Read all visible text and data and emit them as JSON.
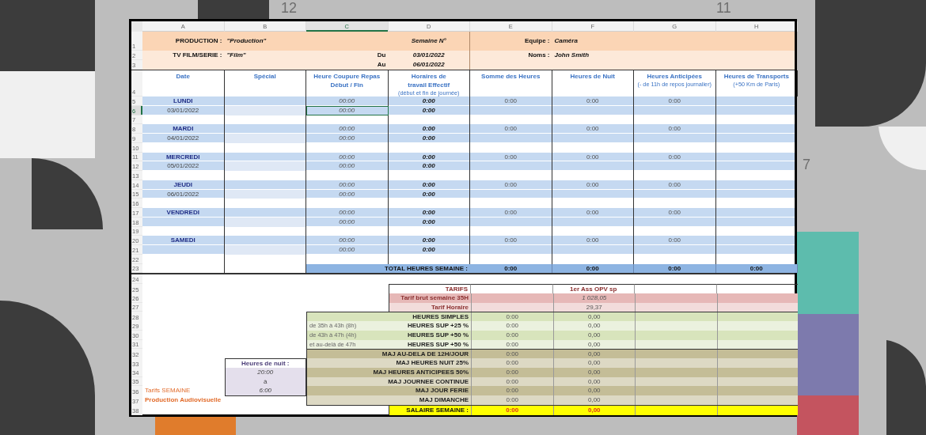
{
  "backdrop_labels": [
    "12",
    "11",
    "7"
  ],
  "column_headers": [
    {
      "label": "A",
      "selected": false
    },
    {
      "label": "B",
      "selected": false
    },
    {
      "label": "C",
      "selected": true
    },
    {
      "label": "D",
      "selected": false
    },
    {
      "label": "E",
      "selected": false
    },
    {
      "label": "F",
      "selected": false
    },
    {
      "label": "G",
      "selected": false
    },
    {
      "label": "H",
      "selected": false
    }
  ],
  "row_numbers": [
    {
      "label": "1",
      "selected": false
    },
    {
      "label": "2",
      "selected": false
    },
    {
      "label": "3",
      "selected": false
    },
    {
      "label": "4",
      "selected": false
    },
    {
      "label": "5",
      "selected": false
    },
    {
      "label": "6",
      "selected": true
    },
    {
      "label": "7",
      "selected": false
    },
    {
      "label": "8",
      "selected": false
    },
    {
      "label": "9",
      "selected": false
    },
    {
      "label": "10",
      "selected": false
    },
    {
      "label": "11",
      "selected": false
    },
    {
      "label": "12",
      "selected": false
    },
    {
      "label": "13",
      "selected": false
    },
    {
      "label": "14",
      "selected": false
    },
    {
      "label": "15",
      "selected": false
    },
    {
      "label": "16",
      "selected": false
    },
    {
      "label": "17",
      "selected": false
    },
    {
      "label": "18",
      "selected": false
    },
    {
      "label": "19",
      "selected": false
    },
    {
      "label": "20",
      "selected": false
    },
    {
      "label": "21",
      "selected": false
    },
    {
      "label": "22",
      "selected": false
    },
    {
      "label": "23",
      "selected": false
    },
    {
      "label": "24",
      "selected": false
    },
    {
      "label": "25",
      "selected": false
    },
    {
      "label": "26",
      "selected": false
    },
    {
      "label": "27",
      "selected": false
    },
    {
      "label": "28",
      "selected": false
    },
    {
      "label": "29",
      "selected": false
    },
    {
      "label": "30",
      "selected": false
    },
    {
      "label": "31",
      "selected": false
    },
    {
      "label": "32",
      "selected": false
    },
    {
      "label": "33",
      "selected": false
    },
    {
      "label": "34",
      "selected": false
    },
    {
      "label": "35",
      "selected": false
    },
    {
      "label": "36",
      "selected": false
    },
    {
      "label": "37",
      "selected": false
    },
    {
      "label": "38",
      "selected": false
    }
  ],
  "header": {
    "production_label": "PRODUCTION :",
    "production_value": "\"Production\"",
    "semaine_label": "Semaine N°",
    "equipe_label": "Equipe :",
    "equipe_value": "Caméra",
    "tv_label": "TV FILM/SERIE :",
    "tv_value": "\"Film\"",
    "du_label": "Du",
    "du_value": "03/01/2022",
    "au_label": "Au",
    "au_value": "06/01/2022",
    "noms_label": "Noms :",
    "noms_value": "John Smith"
  },
  "columns": [
    {
      "title": "Date"
    },
    {
      "title": "Spécial"
    },
    {
      "title": "Heure Coupure Repas Début / Fin"
    },
    {
      "title": "Horaires de travail Effectif",
      "note": "(début et fin de journée)"
    },
    {
      "title": "Somme des Heures"
    },
    {
      "title": "Heures de Nuit"
    },
    {
      "title": "Heures Anticipées",
      "note": "(- de 11h de repos journalier)"
    },
    {
      "title": "Heures de Transports",
      "note": "(+50 Km de Paris)"
    }
  ],
  "days": [
    {
      "day": "LUNDI",
      "date": "03/01/2022",
      "repas": [
        {
          "value": "00:00",
          "selected": false
        },
        {
          "value": "00:00",
          "selected": true
        }
      ],
      "effectif": [
        "0:00",
        "0:00"
      ],
      "somme": "0:00",
      "nuit": "0:00",
      "anticipees": "0:00"
    },
    {
      "day": "MARDI",
      "date": "04/01/2022",
      "repas": [
        {
          "value": "00:00",
          "selected": false
        },
        {
          "value": "00:00",
          "selected": false
        }
      ],
      "effectif": [
        "0:00",
        "0:00"
      ],
      "somme": "0:00",
      "nuit": "0:00",
      "anticipees": "0:00"
    },
    {
      "day": "MERCREDI",
      "date": "05/01/2022",
      "repas": [
        {
          "value": "00:00",
          "selected": false
        },
        {
          "value": "00:00",
          "selected": false
        }
      ],
      "effectif": [
        "0:00",
        "0:00"
      ],
      "somme": "0:00",
      "nuit": "0:00",
      "anticipees": "0:00"
    },
    {
      "day": "JEUDI",
      "date": "06/01/2022",
      "repas": [
        {
          "value": "00:00",
          "selected": false
        },
        {
          "value": "00:00",
          "selected": false
        }
      ],
      "effectif": [
        "0:00",
        "0:00"
      ],
      "somme": "0:00",
      "nuit": "0:00",
      "anticipees": "0:00"
    },
    {
      "day": "VENDREDI",
      "repas": [
        {
          "value": "00:00",
          "selected": false
        },
        {
          "value": "00:00",
          "selected": false
        }
      ],
      "effectif": [
        "0:00",
        "0:00"
      ],
      "somme": "0:00",
      "nuit": "0:00",
      "anticipees": "0:00"
    },
    {
      "day": "SAMEDI",
      "repas": [
        {
          "value": "00:00",
          "selected": false
        },
        {
          "value": "00:00",
          "selected": false
        }
      ],
      "effectif": [
        "0:00",
        "0:00"
      ],
      "somme": "0:00",
      "nuit": "0:00",
      "anticipees": "0:00"
    }
  ],
  "total": {
    "label": "TOTAL HEURES SEMAINE :",
    "values": [
      "0:00",
      "0:00",
      "0:00",
      "0:00"
    ]
  },
  "tarifs": {
    "heading": "TARIFS",
    "role": "1er Ass OPV sp",
    "rows": [
      {
        "label": "Tarif brut semaine 35H",
        "value": "1 028,05"
      },
      {
        "label": "Tarif Horaire",
        "value": "29,37"
      }
    ]
  },
  "majorations": [
    {
      "kind": "heures",
      "label": "HEURES SIMPLES",
      "hours": "0:00",
      "amount": "0,00"
    },
    {
      "kind": "heures",
      "note": "de 35h à 43h (8h)",
      "label": "HEURES SUP +25 %",
      "hours": "0:00",
      "amount": "0,00"
    },
    {
      "kind": "heures",
      "note": "de 43h à 47h (4h)",
      "label": "HEURES SUP +50 %",
      "hours": "0:00",
      "amount": "0,00"
    },
    {
      "kind": "heures",
      "note": "et au-delà de 47h",
      "label": "HEURES SUP +50 %",
      "hours": "0:00",
      "amount": "0,00"
    },
    {
      "kind": "maj",
      "label": "MAJ AU-DELA DE 12H/JOUR",
      "hours": "0:00",
      "amount": "0,00"
    },
    {
      "kind": "maj",
      "label": "MAJ HEURES NUIT 25%",
      "hours": "0:00",
      "amount": "0,00"
    },
    {
      "kind": "maj",
      "label": "MAJ HEURES ANTICIPEES 50%",
      "hours": "0:00",
      "amount": "0,00"
    },
    {
      "kind": "maj",
      "label": "MAJ JOURNEE CONTINUE",
      "hours": "0:00",
      "amount": "0,00"
    },
    {
      "kind": "maj",
      "label": "MAJ JOUR FERIE",
      "hours": "0:00",
      "amount": "0,00"
    },
    {
      "kind": "maj",
      "label": "MAJ DIMANCHE",
      "hours": "0:00",
      "amount": "0,00"
    }
  ],
  "night_hours": {
    "label": "Heures de nuit :",
    "start": "20:00",
    "separator": "à",
    "end": "6:00"
  },
  "footer_notes": [
    "Tarifs SEMAINE",
    "Production Audiovisuelle"
  ],
  "salaire": {
    "label": "SALAIRE SEMAINE :",
    "hours": "0:00",
    "amount": "0,00"
  }
}
